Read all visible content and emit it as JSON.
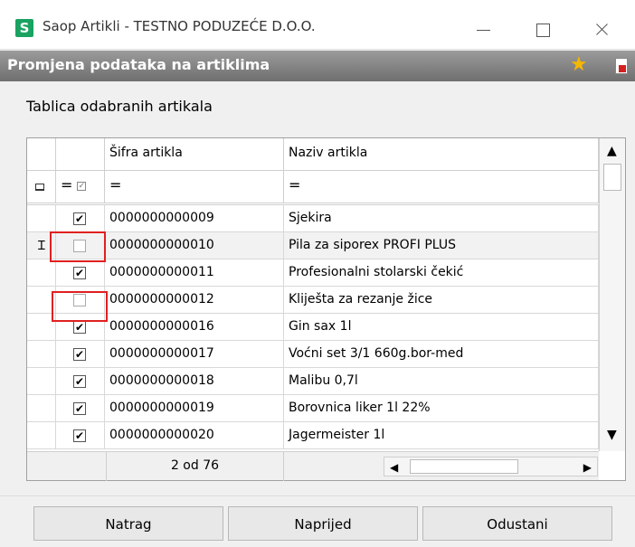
{
  "window": {
    "app_logo": "S",
    "title": "Saop Artikli - TESTNO PODUZEĆE D.O.O."
  },
  "header": {
    "title": "Promjena podataka na artiklima"
  },
  "section_label": "Tablica odabranih artikala",
  "table": {
    "columns": [
      "Šifra artikla",
      "Naziv artikla"
    ],
    "filter_symbol": "=",
    "rows": [
      {
        "checked": true,
        "code": "0000000000009",
        "name": "Sjekira"
      },
      {
        "checked": false,
        "code": "0000000000010",
        "name": "Pila za siporex PROFI PLUS",
        "current": true
      },
      {
        "checked": true,
        "code": "0000000000011",
        "name": "Profesionalni stolarski čekić"
      },
      {
        "checked": false,
        "code": "0000000000012",
        "name": "Kliješta za rezanje žice"
      },
      {
        "checked": true,
        "code": "0000000000016",
        "name": "Gin sax 1l"
      },
      {
        "checked": true,
        "code": "0000000000017",
        "name": "Voćni set 3/1 660g.bor-med"
      },
      {
        "checked": true,
        "code": "0000000000018",
        "name": "Malibu 0,7l"
      },
      {
        "checked": true,
        "code": "0000000000019",
        "name": "Borovnica liker 1l 22%"
      },
      {
        "checked": true,
        "code": "0000000000020",
        "name": "Jagermeister 1l"
      }
    ],
    "record_counter": "2 od 76"
  },
  "buttons": {
    "back": "Natrag",
    "next": "Naprijed",
    "cancel": "Odustani"
  },
  "colors": {
    "header_band": "#7f7f7f",
    "highlight": "#e02020",
    "logo": "#1aa260"
  }
}
